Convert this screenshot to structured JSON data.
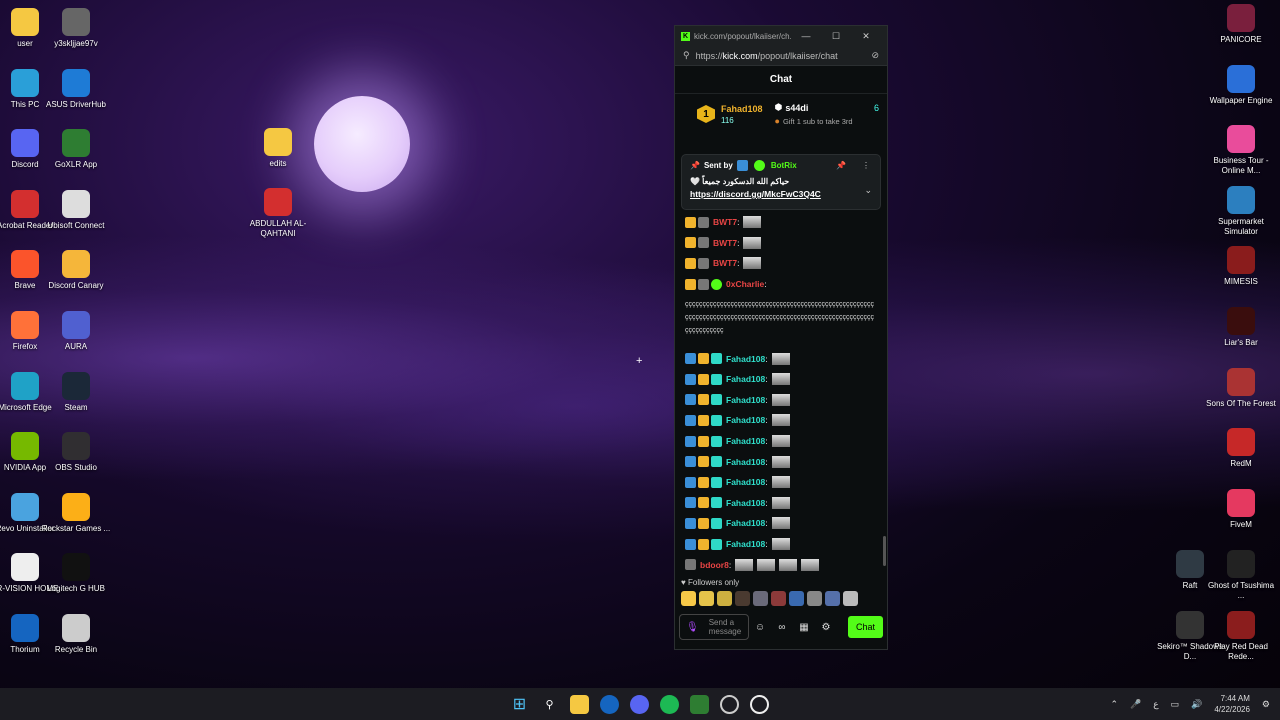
{
  "desktop": {
    "left_icons": [
      {
        "label": "user",
        "icon": "folder-icon",
        "color": "#f5c842"
      },
      {
        "label": "y3skljjae97v",
        "icon": "image-file-icon",
        "color": "#666"
      },
      {
        "label": "This PC",
        "icon": "monitor-icon",
        "color": "#2a9fd8"
      },
      {
        "label": "ASUS DriverHub",
        "icon": "asus-gear-icon",
        "color": "#1e7bd6"
      },
      {
        "label": "Discord",
        "icon": "discord-icon",
        "color": "#5865f2"
      },
      {
        "label": "GoXLR App",
        "icon": "goxlr-icon",
        "color": "#2e7d32"
      },
      {
        "label": "Acrobat Reader",
        "icon": "acrobat-icon",
        "color": "#d32f2f"
      },
      {
        "label": "Ubisoft Connect",
        "icon": "ubisoft-icon",
        "color": "#ddd"
      },
      {
        "label": "Brave",
        "icon": "brave-icon",
        "color": "#fb542b"
      },
      {
        "label": "Discord Canary",
        "icon": "discord-canary-icon",
        "color": "#f5b63a"
      },
      {
        "label": "Firefox",
        "icon": "firefox-icon",
        "color": "#ff7139"
      },
      {
        "label": "AURA",
        "icon": "aura-icon",
        "color": "#5060d0"
      },
      {
        "label": "Microsoft Edge",
        "icon": "edge-icon",
        "color": "#1fa2c7"
      },
      {
        "label": "Steam",
        "icon": "steam-icon",
        "color": "#1b2838"
      },
      {
        "label": "NVIDIA App",
        "icon": "nvidia-icon",
        "color": "#76b900"
      },
      {
        "label": "OBS Studio",
        "icon": "obs-icon",
        "color": "#302e31"
      },
      {
        "label": "Revo Uninstaller",
        "icon": "revo-icon",
        "color": "#4aa3df"
      },
      {
        "label": "Rockstar Games ...",
        "icon": "rockstar-icon",
        "color": "#fcaf17"
      },
      {
        "label": "TR-VISION HOME",
        "icon": "trvision-icon",
        "color": "#eee"
      },
      {
        "label": "Logitech G HUB",
        "icon": "logitech-icon",
        "color": "#111"
      },
      {
        "label": "Thorium",
        "icon": "thorium-icon",
        "color": "#1565c0"
      },
      {
        "label": "Recycle Bin",
        "icon": "recycle-bin-icon",
        "color": "#ccc"
      }
    ],
    "mid_icons": [
      {
        "label": "edits",
        "icon": "folder-icon",
        "color": "#f5c842"
      },
      {
        "label": "ABDULLAH AL-QAHTANI",
        "icon": "pdf-file-icon",
        "color": "#d32f2f"
      }
    ],
    "right_icons": [
      {
        "label": "PANICORE",
        "icon": "panicore-icon",
        "color": "#7a1f3d"
      },
      {
        "label": "Wallpaper Engine",
        "icon": "wallpaper-engine-icon",
        "color": "#2a6fd8"
      },
      {
        "label": "Business Tour - Online M...",
        "icon": "business-tour-icon",
        "color": "#e94c9b"
      },
      {
        "label": "Supermarket Simulator",
        "icon": "supermarket-icon",
        "color": "#2c7fbf"
      },
      {
        "label": "MIMESIS",
        "icon": "mimesis-icon",
        "color": "#8a1c1c"
      },
      {
        "label": "Liar's Bar",
        "icon": "liars-bar-icon",
        "color": "#3a0d0d"
      },
      {
        "label": "Sons Of The Forest",
        "icon": "sons-forest-icon",
        "color": "#a33"
      },
      {
        "label": "RedM",
        "icon": "redm-icon",
        "color": "#c62828"
      },
      {
        "label": "FiveM",
        "icon": "fivem-icon",
        "color": "#e53960"
      },
      {
        "label": "Raft",
        "icon": "raft-icon",
        "color": "#2f3a44"
      },
      {
        "label": "Ghost of Tsushima ...",
        "icon": "ghost-tsushima-icon",
        "color": "#222"
      },
      {
        "label": "Sekiro™ Shadows D...",
        "icon": "sekiro-icon",
        "color": "#333"
      },
      {
        "label": "Play Red Dead Rede...",
        "icon": "rdr-icon",
        "color": "#8b1d1d"
      }
    ]
  },
  "chat_window": {
    "title": "kick.com/popout/lkaiiser/ch...",
    "url_prefix": "https://",
    "url_domain": "kick.com",
    "url_path": "/popout/lkaiiser/chat",
    "header": "Chat",
    "top_gifter": {
      "rank": "1",
      "name": "Fahad108",
      "count": "116"
    },
    "second_gifter": {
      "name": "s44di",
      "count": "6",
      "subtext": "Gift 1 sub to take 3rd"
    },
    "pinned": {
      "sent_by_label": "Sent by",
      "bot_name": "BotRix",
      "arabic_text": "حياكم الله الدسكورد جميعاً 🤍",
      "link": "https://discord.gg/MkcFwC3Q4C"
    },
    "messages": [
      {
        "user": "BWT7",
        "color": "red",
        "badges": [
          "crown",
          "gray"
        ]
      },
      {
        "user": "BWT7",
        "color": "red",
        "badges": [
          "crown",
          "gray"
        ]
      },
      {
        "user": "BWT7",
        "color": "red",
        "badges": [
          "crown",
          "gray"
        ]
      },
      {
        "user": "0xCharlie",
        "color": "red",
        "badges": [
          "crown",
          "gray",
          "green"
        ]
      }
    ],
    "long_message": "ççççççççççççççççççççççççççççççççççççççççççççççççççççççççççççççççççççççççççççççççççççççççççççççççççççççççççççççççççççççç",
    "fahad_messages": [
      {
        "user": "Fahad108"
      },
      {
        "user": "Fahad108"
      },
      {
        "user": "Fahad108"
      },
      {
        "user": "Fahad108"
      },
      {
        "user": "Fahad108"
      },
      {
        "user": "Fahad108"
      },
      {
        "user": "Fahad108"
      },
      {
        "user": "Fahad108"
      },
      {
        "user": "Fahad108"
      },
      {
        "user": "Fahad108"
      }
    ],
    "last_message": {
      "user": "bdoor8"
    },
    "followers_only": "Followers only",
    "input_placeholder": "Send a message",
    "chat_button": "Chat"
  },
  "taskbar": {
    "time": "7:44 AM",
    "date": "4/22/2026",
    "lang": "ع"
  }
}
